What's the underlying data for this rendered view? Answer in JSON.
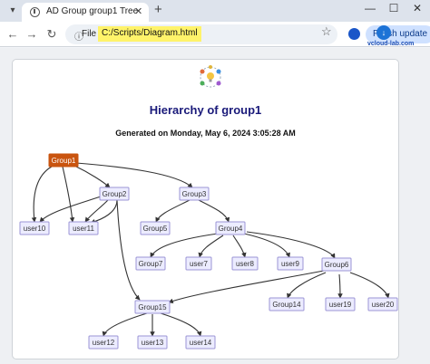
{
  "browser": {
    "tab_title": "AD Group group1 Tree",
    "url_scheme_label": "File",
    "url": "C:/Scripts/Diagram.html",
    "finish_update_label": "Finish update",
    "watermark_text": "vcloud-lab.com"
  },
  "page": {
    "title": "Hierarchy of group1",
    "generated": "Generated on Monday, May 6, 2024 3:05:28 AM"
  },
  "diagram": {
    "nodes": {
      "group1": "Group1",
      "group2": "Group2",
      "group3": "Group3",
      "group4": "Group4",
      "group5": "Group5",
      "group6": "Group6",
      "group7": "Group7",
      "group14": "Group14",
      "group15": "Group15",
      "user7": "user7",
      "user8": "user8",
      "user9": "user9",
      "user10": "user10",
      "user11": "user11",
      "user12": "user12",
      "user13": "user13",
      "user14": "user14",
      "user19": "user19",
      "user20": "user20"
    }
  }
}
